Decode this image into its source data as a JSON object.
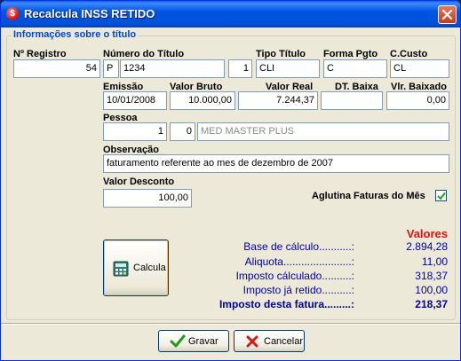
{
  "window": {
    "title": "Recalcula INSS RETIDO"
  },
  "group": {
    "title": "Informações sobre o título"
  },
  "fields": {
    "registro": {
      "label": "Nº Registro",
      "value": "54"
    },
    "numero": {
      "label": "Número do Título",
      "prefix": "P",
      "value": "1234",
      "parcela": "1"
    },
    "tipo": {
      "label": "Tipo Título",
      "value": "CLI"
    },
    "forma": {
      "label": "Forma Pgto",
      "value": "C"
    },
    "custo": {
      "label": "C.Custo",
      "value": "CL"
    },
    "emissao": {
      "label": "Emissão",
      "value": "10/01/2008"
    },
    "valor_bruto": {
      "label": "Valor Bruto",
      "value": "10.000,00"
    },
    "valor_real": {
      "label": "Valor Real",
      "value": "7.244,37"
    },
    "dt_baixa": {
      "label": "DT. Baixa",
      "value": ""
    },
    "vlr_baixado": {
      "label": "Vlr. Baixado",
      "value": "0,00"
    },
    "pessoa": {
      "label": "Pessoa",
      "code1": "1",
      "code2": "0",
      "name": "MED MASTER PLUS"
    },
    "observacao": {
      "label": "Observação",
      "value": "faturamento referente ao mes de dezembro de 2007"
    },
    "valor_desconto": {
      "label": "Valor Desconto",
      "value": "100,00"
    }
  },
  "aglutina": {
    "label": "Aglutina Faturas do Mês",
    "checked": true
  },
  "calcula": {
    "label": "Calcula"
  },
  "summary": {
    "header": "Valores",
    "rows": [
      {
        "label": "Base de cálculo...........:",
        "value": "2.894,28"
      },
      {
        "label": "Aliquota.......................:",
        "value": "11,00"
      },
      {
        "label": "Imposto cálculado..........:",
        "value": "318,37"
      },
      {
        "label": "Imposto já retido..........:",
        "value": "100,00"
      }
    ],
    "total": {
      "label": "Imposto desta fatura.........:",
      "value": "218,37"
    }
  },
  "buttons": {
    "save": "Gravar",
    "cancel": "Cancelar"
  },
  "colors": {
    "title_bar": "#0054e3",
    "summary_text": "#0000a0",
    "summary_header": "#e01010",
    "group_title": "#0046d5"
  }
}
